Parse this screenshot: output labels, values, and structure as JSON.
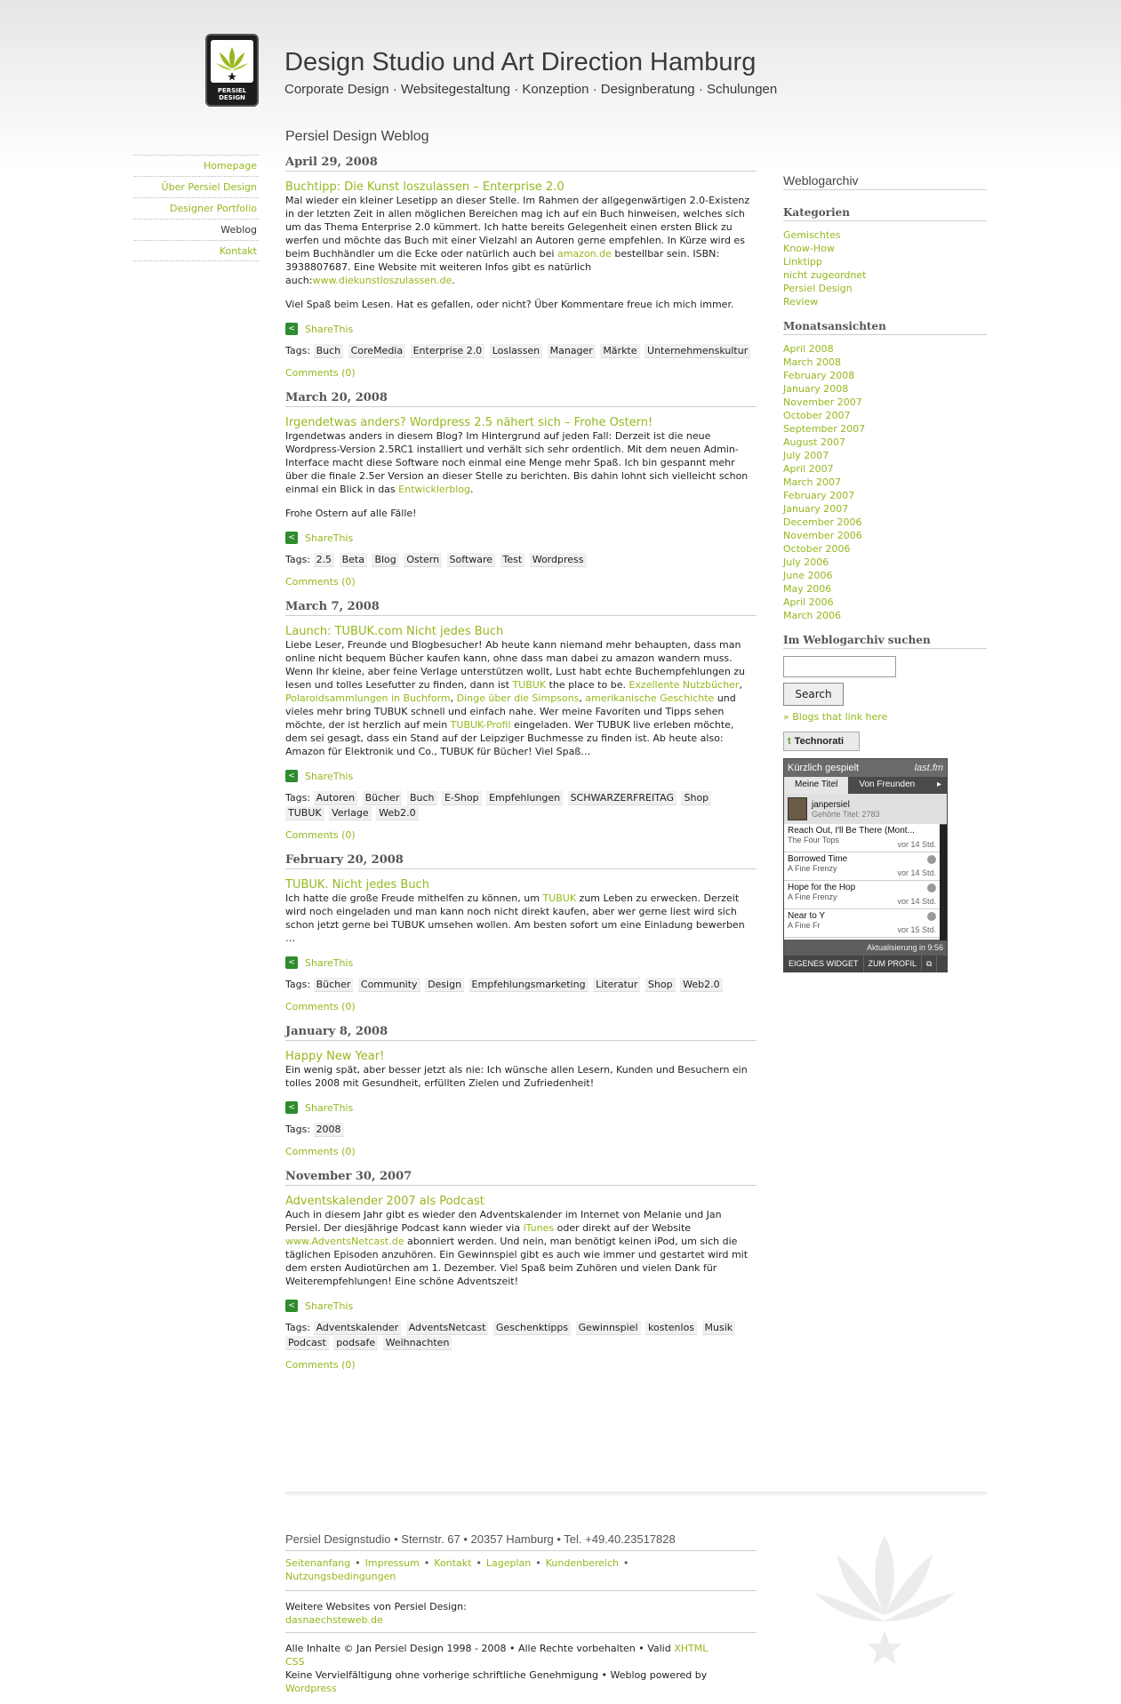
{
  "header": {
    "logo_text_1": "PERSIEL",
    "logo_text_2": "DESIGN",
    "title": "Design Studio und Art Direction Hamburg",
    "subtitle": "Corporate Design · Websitegestaltung · Konzeption · Designberatung · Schulungen"
  },
  "nav": {
    "items": [
      {
        "label": "Homepage"
      },
      {
        "label": "Über Persiel Design"
      },
      {
        "label": "Designer Portfolio"
      },
      {
        "label": "Weblog"
      },
      {
        "label": "Kontakt"
      }
    ]
  },
  "main": {
    "title": "Persiel Design Weblog"
  },
  "labels": {
    "share": "ShareThis",
    "tags": "Tags:",
    "comments": "Comments (0)"
  },
  "posts": [
    {
      "date": "April 29, 2008",
      "title": "Buchtipp: Die Kunst loszulassen – Enterprise 2.0",
      "p1a": "Mal wieder ein kleiner Lesetipp an dieser Stelle. Im Rahmen der allgegenwärtigen 2.0-Existenz in der letzten Zeit in allen möglichen Bereichen mag ich auf ein Buch hinweisen, welches sich um das Thema Enterprise 2.0 kümmert. Ich hatte bereits Gelegenheit einen ersten Blick zu werfen und möchte das Buch mit einer Vielzahl an Autoren gerne empfehlen. In Kürze wird es beim Buchhändler um die Ecke oder natürlich auch bei ",
      "l1": "amazon.de",
      "p1b": " bestellbar sein. ISBN: 3938807687. Eine Website mit weiteren Infos gibt es natürlich auch:",
      "l2": "www.diekunstloszulassen.de",
      "p1c": ".",
      "p2": "Viel Spaß beim Lesen. Hat es gefallen, oder nicht? Über Kommentare freue ich mich immer.",
      "tags": [
        "Buch",
        "CoreMedia",
        "Enterprise 2.0",
        "Loslassen",
        "Manager",
        "Märkte",
        "Unternehmenskultur"
      ]
    },
    {
      "date": "March 20, 2008",
      "title": "Irgendetwas anders? Wordpress 2.5 nähert sich – Frohe Ostern!",
      "p1a": "Irgendetwas anders in diesem Blog? Im Hintergrund auf jeden Fall: Derzeit ist die neue Wordpress-Version 2.5RC1 installiert und verhält sich sehr ordentlich. Mit dem neuen Admin-Interface macht diese Software noch einmal eine Menge mehr Spaß. Ich bin gespannt mehr über die finale 2.5er Version an dieser Stelle zu berichten. Bis dahin lohnt sich vielleicht schon einmal ein Blick in das ",
      "l1": "Entwicklerblog",
      "p1b": ".",
      "p2": "Frohe Ostern auf alle Fälle!",
      "tags": [
        "2.5",
        "Beta",
        "Blog",
        "Ostern",
        "Software",
        "Test",
        "Wordpress"
      ]
    },
    {
      "date": "March 7, 2008",
      "title": "Launch: TUBUK.com Nicht jedes Buch",
      "p1a": "Liebe Leser, Freunde und Blogbesucher! Ab heute kann niemand mehr behaupten, dass man online nicht bequem Bücher kaufen kann, ohne dass man dabei zu amazon wandern muss. Wenn Ihr kleine, aber feine Verlage unterstützen wollt, Lust habt echte Buchempfehlungen zu lesen und tolles Lesefutter zu finden, dann ist ",
      "l1": "TUBUK",
      "p1b": " the place to be. ",
      "l2": "Exzellente Nutzbücher",
      "sep1": ", ",
      "l3": "Polaroidsammlungen in Buchform",
      "sep2": ", ",
      "l4": "Dinge über die Simpsons",
      "sep3": ", ",
      "l5": "amerikanische Geschichte",
      "p1c": " und vieles mehr bring TUBUK schnell und einfach nahe. Wer meine Favoriten und Tipps sehen möchte, der ist herzlich auf mein ",
      "l6": "TUBUK-Profil",
      "p1d": " eingeladen. Wer TUBUK live erleben möchte, dem sei gesagt, dass ein Stand auf der Leipziger Buchmesse zu finden ist. Ab heute also: Amazon für Elektronik und Co., TUBUK für Bücher! Viel Spaß…",
      "tags": [
        "Autoren",
        "Bücher",
        "Buch",
        "E-Shop",
        "Empfehlungen",
        "SCHWARZERFREITAG",
        "Shop",
        "TUBUK",
        "Verlage",
        "Web2.0"
      ]
    },
    {
      "date": "February 20, 2008",
      "title": "TUBUK. Nicht jedes Buch",
      "p1a": "Ich hatte die große Freude mithelfen zu können, um ",
      "l1": "TUBUK",
      "p1b": " zum Leben zu erwecken. Derzeit wird noch eingeladen und man kann noch nicht direkt kaufen, aber wer gerne liest wird sich schon jetzt gerne bei TUBUK umsehen wollen. Am besten sofort um eine Einladung bewerben …",
      "tags": [
        "Bücher",
        "Community",
        "Design",
        "Empfehlungsmarketing",
        "Literatur",
        "Shop",
        "Web2.0"
      ]
    },
    {
      "date": "January 8, 2008",
      "title": "Happy New Year!",
      "p1a": "Ein wenig spät, aber besser jetzt als nie: Ich wünsche allen Lesern, Kunden und Besuchern ein tolles 2008 mit Gesundheit, erfüllten Zielen und Zufriedenheit!",
      "tags": [
        "2008"
      ]
    },
    {
      "date": "November 30, 2007",
      "title": "Adventskalender 2007 als Podcast",
      "p1a": "Auch in diesem Jahr gibt es wieder den Adventskalender im Internet von Melanie und Jan Persiel. Der diesjährige Podcast kann wieder via ",
      "l1": "iTunes",
      "p1b": " oder direkt auf der Website ",
      "l2": "www.AdventsNetcast.de",
      "p1c": " abonniert werden. Und nein, man benötigt keinen iPod, um sich die täglichen Episoden anzuhören. Ein Gewinnspiel gibt es auch wie immer und gestartet wird mit dem ersten Audiotürchen am 1. Dezember. Viel Spaß beim Zuhören und vielen Dank für Weiterempfehlungen! Eine schöne Adventszeit!",
      "tags": [
        "Adventskalender",
        "AdventsNetcast",
        "Geschenktipps",
        "Gewinnspiel",
        "kostenlos",
        "Musik",
        "Podcast",
        "podsafe",
        "Weihnachten"
      ]
    }
  ],
  "sidebar": {
    "title": "Weblogarchiv",
    "categories_head": "Kategorien",
    "categories": [
      "Gemischtes",
      "Know-How",
      "Linktipp",
      "nicht zugeordnet",
      "Persiel Design",
      "Review"
    ],
    "months_head": "Monatsansichten",
    "months": [
      "April 2008",
      "March 2008",
      "February 2008",
      "January 2008",
      "November 2007",
      "October 2007",
      "September 2007",
      "August 2007",
      "July 2007",
      "April 2007",
      "March 2007",
      "February 2007",
      "January 2007",
      "December 2006",
      "November 2006",
      "October 2006",
      "July 2006",
      "June 2006",
      "May 2006",
      "April 2006",
      "March 2006"
    ],
    "search_head": "Im Weblogarchiv suchen",
    "search_button": "Search",
    "blogs_link": "» Blogs that link here",
    "technorati": "Technorati",
    "technorati_icon": "technorati-icon"
  },
  "lastfm": {
    "header": "Kürzlich gespielt",
    "brand": "last.fm",
    "tab_mine": "Meine Titel",
    "tab_friends": "Von Freunden",
    "next": "▸",
    "user": "janpersiel",
    "count": "Gehörte Titel: 2783",
    "tracks": [
      {
        "song": "Reach Out, I'll Be There (Mont...",
        "artist": "The Four Tops",
        "ago": "vor 14 Std."
      },
      {
        "song": "Borrowed Time",
        "artist": "A Fine Frenzy",
        "ago": "vor 14 Std."
      },
      {
        "song": "Hope for the Hop",
        "artist": "A Fine Frenzy",
        "ago": "vor 14 Std."
      },
      {
        "song": "Near to Y",
        "artist": "A Fine Fr",
        "ago": "vor 15 Std."
      }
    ],
    "update": "Aktualisierung in 9:56",
    "bottom_left": "EIGENES WIDGET",
    "bottom_right": "ZUM PROFIL"
  },
  "footer": {
    "address": "Persiel Designstudio  •  Sternstr. 67  •  20357 Hamburg  •  Tel. +49.40.23517828",
    "links": [
      "Seitenanfang",
      "Impressum",
      "Kontakt",
      "Lageplan",
      "Kundenbereich",
      "Nutzungsbedingungen"
    ],
    "bullet": "•",
    "more_label": "Weitere Websites von Persiel Design:",
    "more_link": "dasnaechsteweb.de",
    "legal_1": "Alle Inhalte © Jan Persiel Design 1998 - 2008  •  Alle Rechte vorbehalten  •  Valid ",
    "xhtml": "XHTML",
    "css": "CSS",
    "legal_2": "Keine Vervielfältigung ohne vorherige schriftliche Genehmigung  •  Weblog powered by ",
    "wordpress": "Wordpress"
  },
  "colors": {
    "accent": "#95b81e",
    "text": "#222222",
    "rule": "#cfcfcf"
  }
}
